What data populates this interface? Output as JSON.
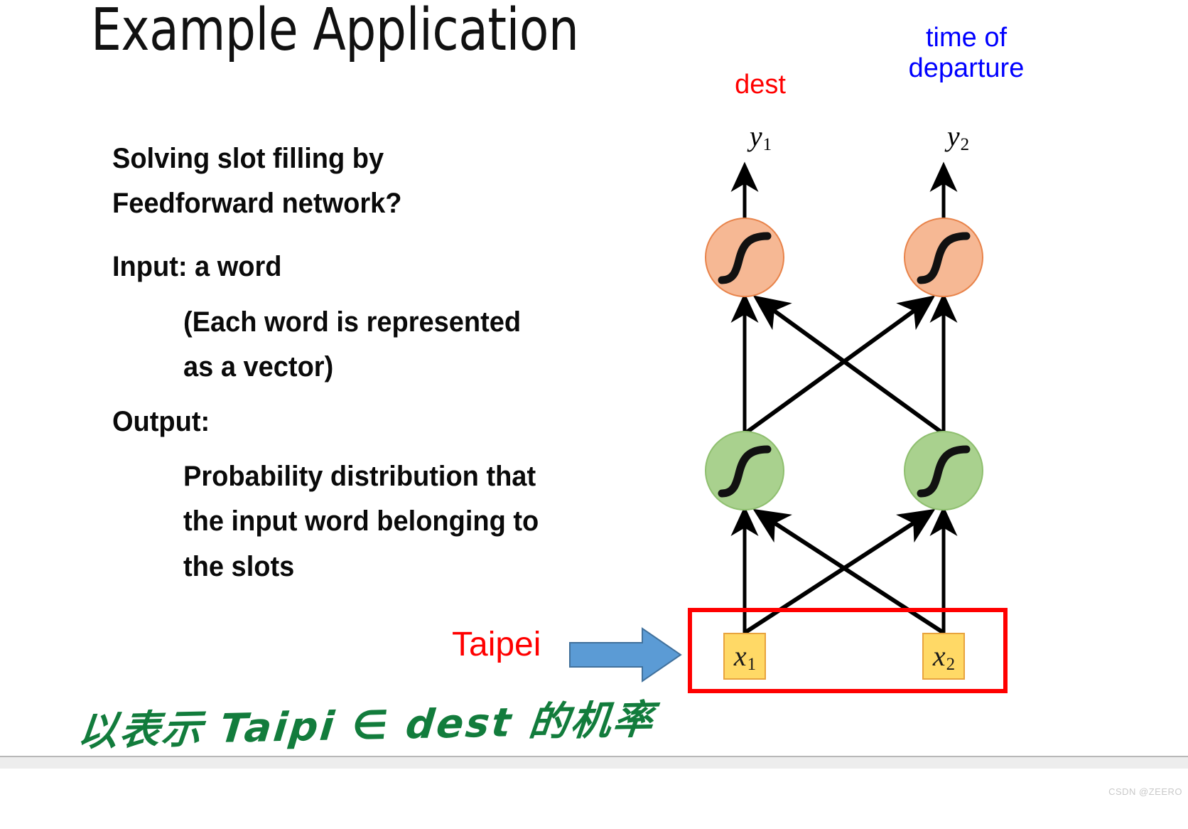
{
  "slide": {
    "title": "Example Application",
    "background_color": "#FFFFFF"
  },
  "body": {
    "paragraphs": [
      {
        "text": "Solving slot filling by\nFeedforward network?",
        "indented": false
      },
      {
        "text": "Input: a word",
        "indented": false
      },
      {
        "text": "(Each word is represented\nas a vector)",
        "indented": true
      },
      {
        "text": "Output:",
        "indented": false
      },
      {
        "text": "Probability distribution that\nthe input word belonging to\nthe slots",
        "indented": true
      }
    ]
  },
  "network": {
    "slot_labels": {
      "left": "dest",
      "left_color": "#FF0000",
      "right": "time of\ndeparture",
      "right_color": "#0000FF"
    },
    "outputs": [
      {
        "base": "y",
        "sub": "1"
      },
      {
        "base": "y",
        "sub": "2"
      }
    ],
    "inputs": [
      {
        "base": "x",
        "sub": "1"
      },
      {
        "base": "x",
        "sub": "2"
      }
    ],
    "layers": [
      {
        "name": "output-layer",
        "activation": "sigmoid",
        "fill": "#F6B894",
        "stroke": "#E8834A",
        "count": 2
      },
      {
        "name": "hidden-layer",
        "activation": "sigmoid",
        "fill": "#A9D18E",
        "stroke": "#8FBF6F",
        "count": 2
      }
    ],
    "input_frame_color": "#FF0000",
    "input_box_fill": "#FFD966",
    "input_box_stroke": "#E8A33D"
  },
  "input_example": {
    "word": "Taipei",
    "word_color": "#FF0000",
    "arrow_color": "#5B9BD5"
  },
  "annotation": {
    "handwriting": "以表示 Taipi ∈ dest 的机率",
    "color": "#127C3C"
  },
  "footer": {
    "watermark": "CSDN @ZEERO"
  }
}
